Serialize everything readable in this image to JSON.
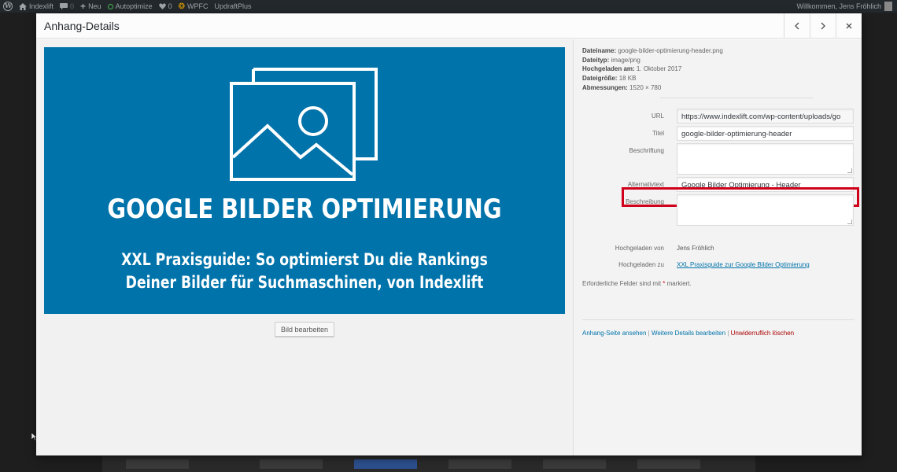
{
  "adminbar": {
    "site_name": "Indexlift",
    "comments_count": "0",
    "new_label": "Neu",
    "autoptimize_label": "Autoptimize",
    "updates_count": "0",
    "wpfc_label": "WPFC",
    "updraft_label": "UpdraftPlus",
    "welcome": "Willkommen, Jens Fröhlich"
  },
  "modal": {
    "title": "Anhang-Details",
    "prev_icon": "chevron-left-icon",
    "next_icon": "chevron-right-icon",
    "close_icon": "close-icon"
  },
  "preview": {
    "title": "GOOGLE BILDER OPTIMIERUNG",
    "subtitle_line1": "XXL Praxisguide: So optimierst Du die Rankings",
    "subtitle_line2": "Deiner Bilder für Suchmaschinen, von Indexlift",
    "background_color": "#0073aa",
    "edit_button": "Bild bearbeiten"
  },
  "meta": {
    "filename_label": "Dateiname:",
    "filename": "google-bilder-optimierung-header.png",
    "filetype_label": "Dateityp:",
    "filetype": "image/png",
    "uploaded_label": "Hochgeladen am:",
    "uploaded": "1. Oktober 2017",
    "filesize_label": "Dateigröße:",
    "filesize": "18 KB",
    "dimensions_label": "Abmessungen:",
    "dimensions": "1520 × 780"
  },
  "fields": {
    "url_label": "URL",
    "url_value": "https://www.indexlift.com/wp-content/uploads/go",
    "title_label": "Titel",
    "title_value": "google-bilder-optimierung-header",
    "caption_label": "Beschriftung",
    "alt_label": "Alternativtext",
    "alt_value": "Google Bilder Optimierung - Header",
    "description_label": "Beschreibung",
    "uploaded_by_label": "Hochgeladen von",
    "uploaded_by_value": "Jens Fröhlich",
    "uploaded_to_label": "Hochgeladen zu",
    "uploaded_to_value": "XXL Praxisguide zur Google Bilder Optimierung"
  },
  "required_note": {
    "text": "Erforderliche Felder sind mit",
    "star": "*",
    "suffix": "markiert."
  },
  "actions": {
    "view": "Anhang-Seite ansehen",
    "more": "Weitere Details bearbeiten",
    "delete": "Unwiderruflich löschen",
    "separator": "|"
  },
  "colors": {
    "highlight": "#d0021b",
    "link": "#0073aa",
    "delete": "#aa0000"
  }
}
